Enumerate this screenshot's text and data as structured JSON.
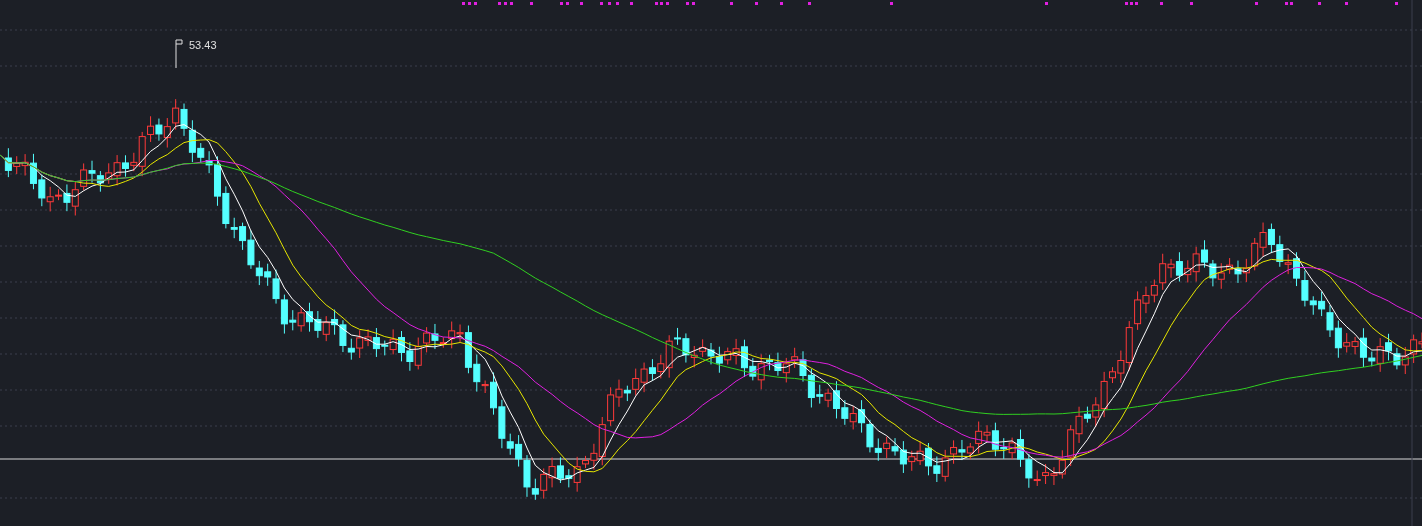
{
  "chart": {
    "high_price_label": "53.43"
  }
}
